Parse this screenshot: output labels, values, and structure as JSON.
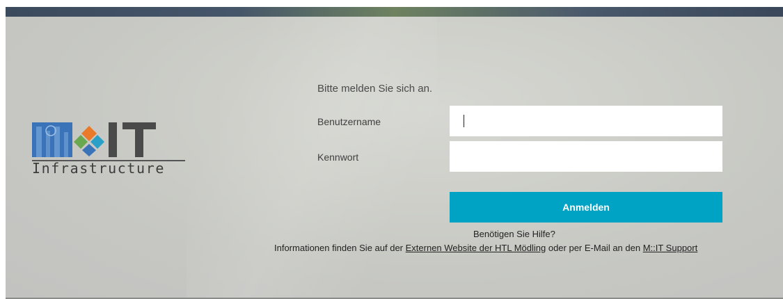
{
  "brand": {
    "logo_subtitle": "Infrastructure",
    "colors": {
      "blue": "#3b73b9",
      "orange": "#e87a2a",
      "green": "#6aa84f",
      "teal": "#2aa0c8",
      "gray": "#444444"
    }
  },
  "form": {
    "prompt": "Bitte melden Sie sich an.",
    "username_label": "Benutzername",
    "username_value": "",
    "password_label": "Kennwort",
    "password_value": "",
    "submit_label": "Anmelden"
  },
  "help": {
    "question": "Benötigen Sie Hilfe?",
    "info_prefix": "Informationen finden Sie auf der ",
    "link_website": "Externen Website der HTL Mödling",
    "info_middle": " oder per E-Mail an den ",
    "link_support": "M::IT Support"
  },
  "theme": {
    "accent": "#00a3c4"
  }
}
